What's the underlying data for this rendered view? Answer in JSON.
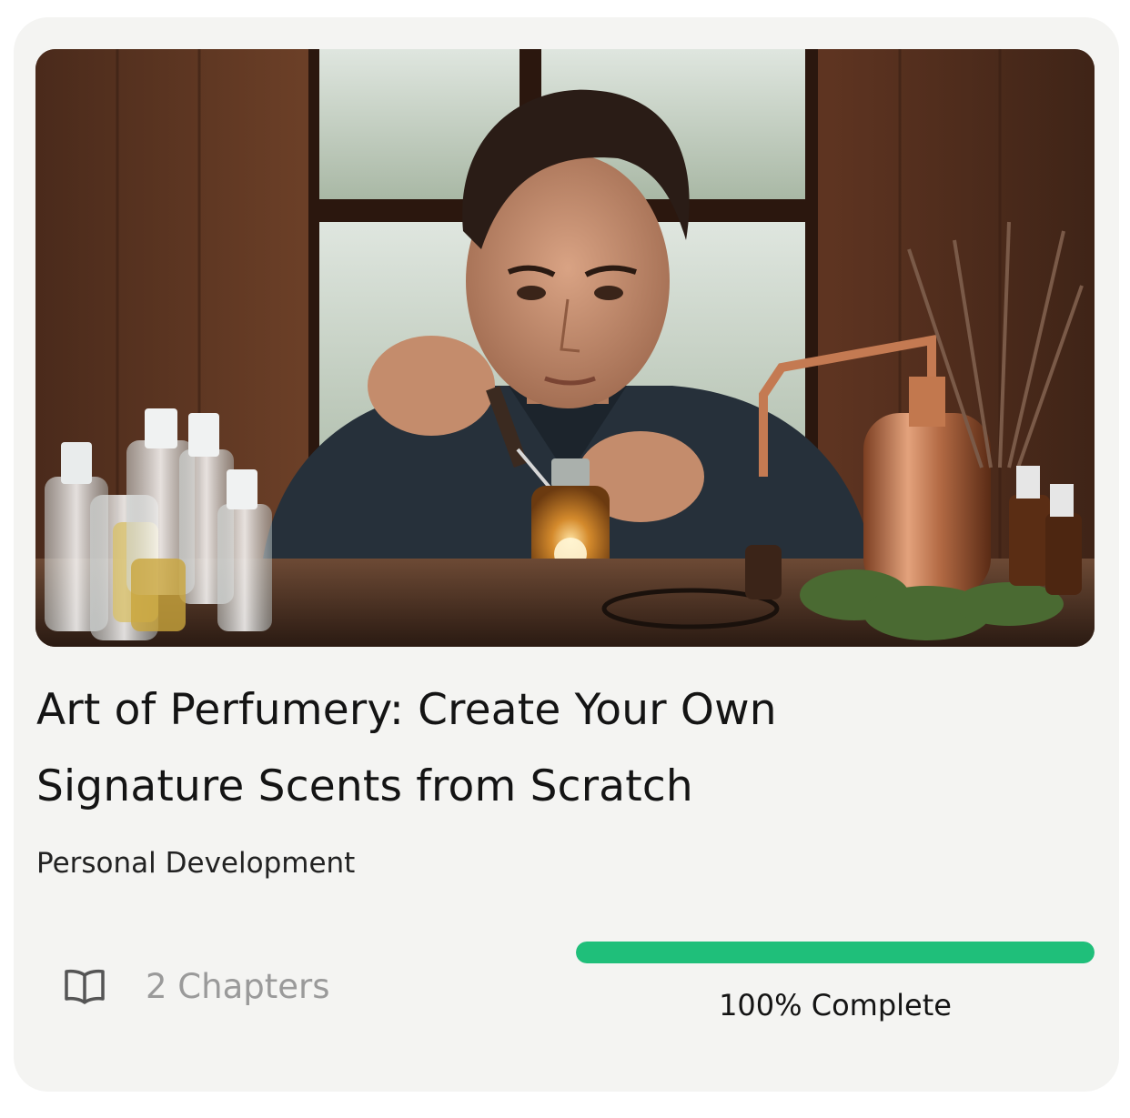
{
  "course": {
    "title_line1": "Art of Perfumery: Create Your Own",
    "title_line2": "Signature Scents from Scratch",
    "category": "Personal Development",
    "chapters_label": "2 Chapters",
    "chapters_icon": "book-open-icon",
    "image_subject": "man with dropper and perfume bottle at wooden table",
    "progress": {
      "percent": 100,
      "label": "100% Complete",
      "color": "#1fbf7a"
    }
  }
}
